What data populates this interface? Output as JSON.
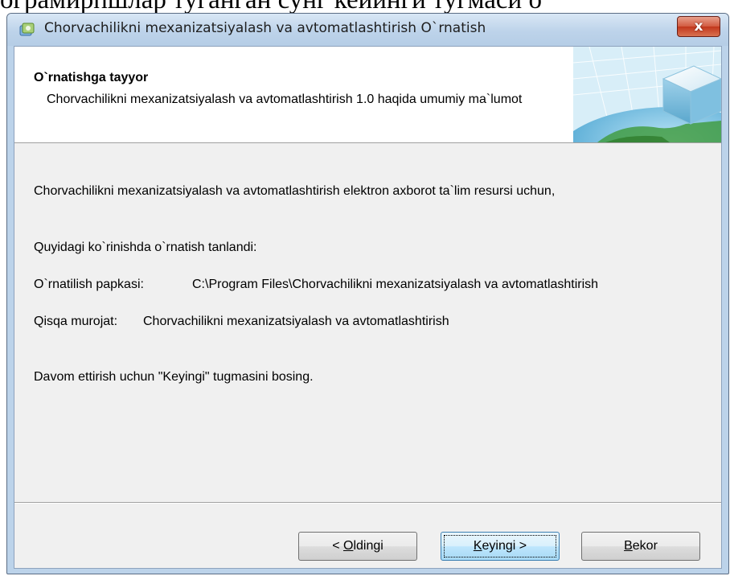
{
  "background_caption": "ограмирпшлар туганган сунг кейинги тугмаси о",
  "window": {
    "title": "Chorvachilikni mexanizatsiyalash va avtomatlashtirish O`rnatish",
    "close_glyph": "x"
  },
  "banner": {
    "title": "O`rnatishga tayyor",
    "subtitle": "Chorvachilikni mexanizatsiyalash va avtomatlashtirish 1.0 haqida umumiy ma`lumot"
  },
  "body": {
    "line1": "Chorvachilikni mexanizatsiyalash va avtomatlashtirish elektron axborot ta`lim resursi uchun,",
    "line2": "Quyidagi ko`rinishda o`rnatish tanlandi:",
    "install_folder_label": "O`rnatilish papkasi:",
    "install_folder_value": "C:\\Program Files\\Chorvachilikni mexanizatsiyalash va avtomatlashtirish",
    "shortcut_label": "Qisqa murojat:",
    "shortcut_value": "Chorvachilikni mexanizatsiyalash va avtomatlashtirish",
    "instruction": "Davom ettirish uchun \"Keyingi\" tugmasini bosing."
  },
  "buttons": {
    "back": {
      "prefix": "< ",
      "accel": "O",
      "rest": "ldingi"
    },
    "next": {
      "prefix": "",
      "accel": "K",
      "rest": "eyingi >"
    },
    "cancel": {
      "prefix": "",
      "accel": "B",
      "rest": "ekor"
    }
  },
  "icons": {
    "title_icon": "installer-icon",
    "banner_graphic": "globe-cube-graphic"
  },
  "colors": {
    "titlebar": "#bdd3ea",
    "close_button": "#c2371c",
    "client_background": "#f0f0f0",
    "focused_button": "#bee6fd"
  }
}
